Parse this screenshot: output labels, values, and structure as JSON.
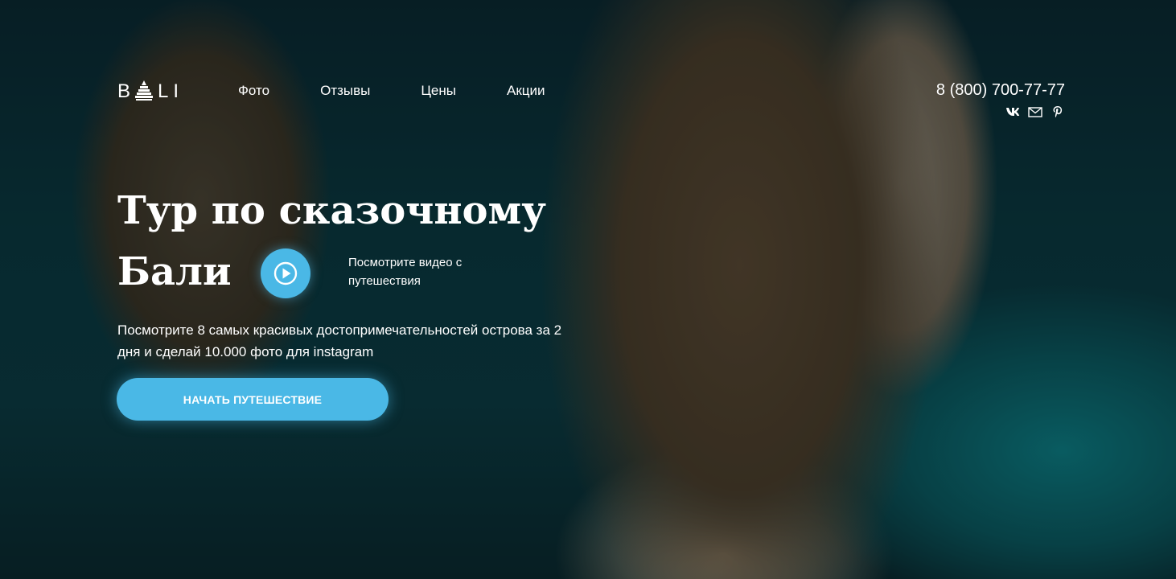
{
  "header": {
    "logo_text": "BALI",
    "logo_left": "B",
    "logo_right": "LI",
    "nav": [
      {
        "label": "Фото"
      },
      {
        "label": "Отзывы"
      },
      {
        "label": "Цены"
      },
      {
        "label": "Акции"
      }
    ],
    "phone": "8 (800) 700-77-77",
    "socials": [
      "vk-icon",
      "mail-icon",
      "pinterest-icon"
    ]
  },
  "hero": {
    "title_line1": "Тур по сказочному",
    "title_line2": "Бали",
    "video_caption": "Посмотрите видео с путешествия",
    "subtitle": "Посмотрите 8 самых красивых достопримечательностей острова за 2 дня и сделай 10.000 фото для instagram",
    "cta_label": "НАЧАТЬ ПУТЕШЕСТВИЕ"
  },
  "colors": {
    "accent": "#4ab8e6",
    "text": "#ffffff"
  }
}
